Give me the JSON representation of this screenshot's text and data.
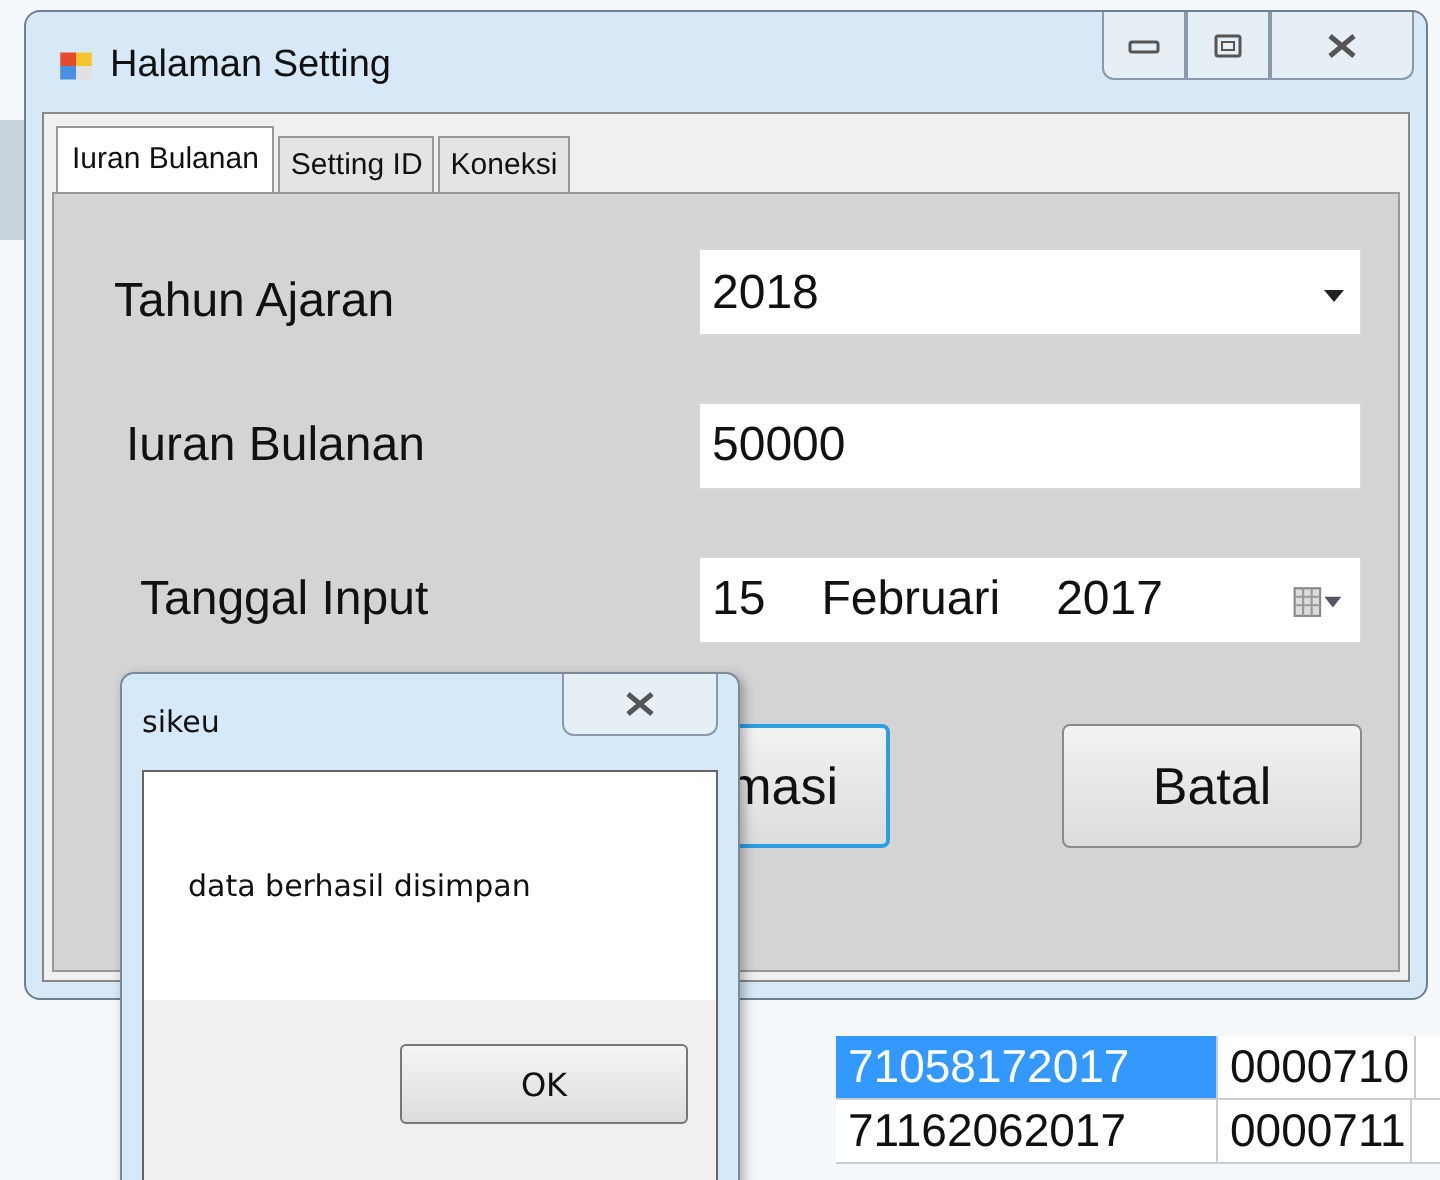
{
  "window": {
    "title": "Halaman Setting"
  },
  "tabs": [
    {
      "label": "Iuran Bulanan",
      "selected": true
    },
    {
      "label": "Setting ID",
      "selected": false
    },
    {
      "label": "Koneksi",
      "selected": false
    }
  ],
  "form": {
    "tahun_ajaran": {
      "label": "Tahun Ajaran",
      "value": "2018"
    },
    "iuran_bulanan": {
      "label": "Iuran Bulanan",
      "value": "50000"
    },
    "tanggal_input": {
      "label": "Tanggal Input",
      "day": "15",
      "month": "Februari",
      "year": "2017"
    }
  },
  "buttons": [
    {
      "label": "masi",
      "focused": true
    },
    {
      "label": "Batal",
      "focused": false
    }
  ],
  "background_table": {
    "rows": [
      {
        "cells": [
          "71058172017",
          "0000710"
        ],
        "selected": true
      },
      {
        "cells": [
          "71162062017",
          "0000711"
        ],
        "selected": false
      }
    ]
  },
  "message_box": {
    "title": "sikeu",
    "message": "data berhasil disimpan",
    "button": "OK"
  }
}
